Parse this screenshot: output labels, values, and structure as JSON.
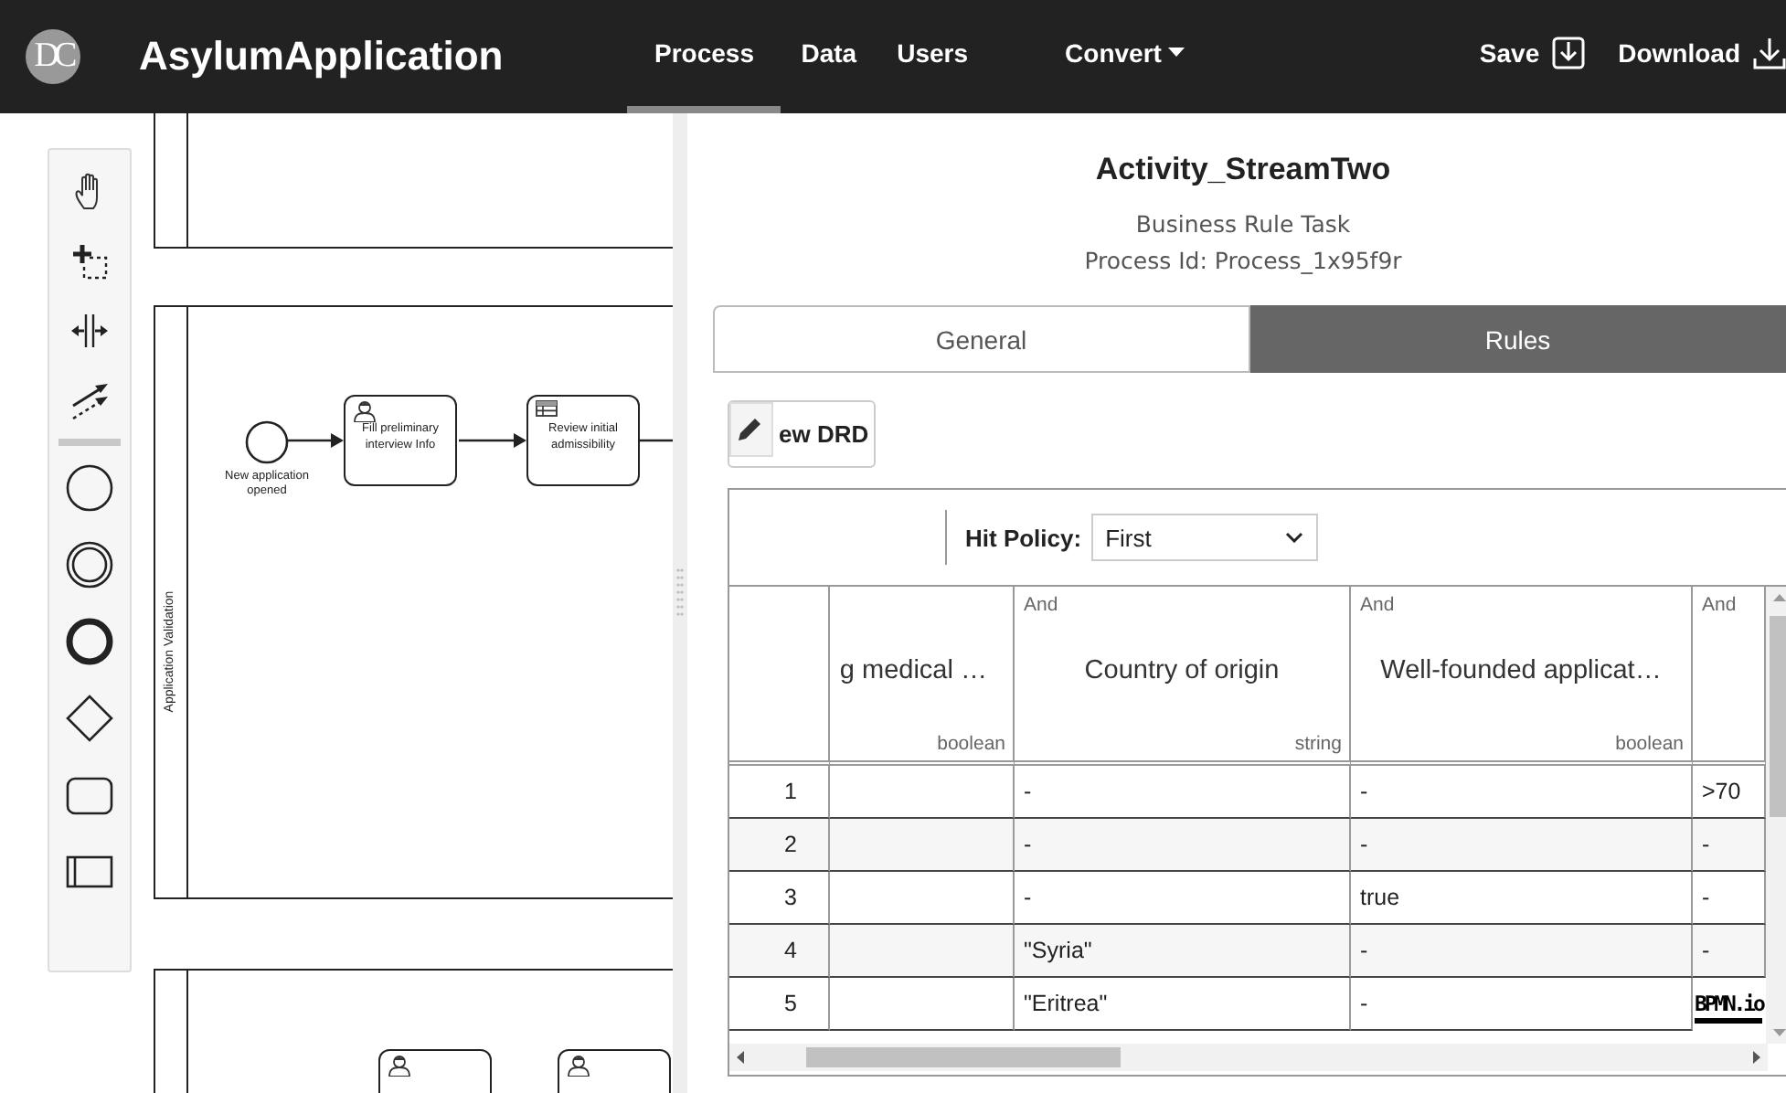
{
  "navbar": {
    "logo_text": "DC",
    "app_title": "AsylumApplication",
    "nav_items": [
      {
        "label": "Process",
        "selected": true
      },
      {
        "label": "Data",
        "selected": false
      },
      {
        "label": "Users",
        "selected": false
      }
    ],
    "convert": {
      "label": "Convert"
    },
    "actions": [
      {
        "label": "Save",
        "kind": "save"
      },
      {
        "label": "Download",
        "kind": "download"
      }
    ]
  },
  "palette": {
    "tools": [
      {
        "kind": "hand"
      },
      {
        "kind": "lasso"
      },
      {
        "kind": "space"
      },
      {
        "kind": "connect"
      },
      {
        "kind": "separator"
      },
      {
        "kind": "start-event"
      },
      {
        "kind": "intermediate-event"
      },
      {
        "kind": "end-event"
      },
      {
        "kind": "gateway"
      },
      {
        "kind": "task"
      },
      {
        "kind": "pool"
      }
    ]
  },
  "canvas": {
    "lane_label": "Application Validation",
    "start_event": {
      "label": "New application opened"
    },
    "tasks": [
      {
        "kind": "user",
        "label": "Fill preliminary interview Info"
      },
      {
        "kind": "business-rule",
        "label": "Review initial admissibility"
      }
    ],
    "lower_tasks": [
      {
        "kind": "user"
      },
      {
        "kind": "user"
      }
    ]
  },
  "panel": {
    "title": "Activity_StreamTwo",
    "subtitle": "Business Rule Task",
    "process_id": "Process Id: Process_1x95f9r",
    "tabs": [
      {
        "label": "General",
        "selected": false
      },
      {
        "label": "Rules",
        "selected": true
      }
    ],
    "view_drd_button": "ew DRD",
    "hit_policy": {
      "label": "Hit Policy:",
      "value": "First"
    },
    "table": {
      "columns": [
        {
          "label": "g medical …",
          "type": "boolean"
        },
        {
          "combinator": "And",
          "label": "Country of origin",
          "type": "string"
        },
        {
          "combinator": "And",
          "label": "Well-founded applicat…",
          "type": "boolean"
        },
        {
          "combinator": "And"
        }
      ],
      "rows": [
        {
          "number": "1",
          "values": [
            "-",
            "-",
            ">70"
          ]
        },
        {
          "number": "2",
          "values": [
            "-",
            "-",
            "-"
          ]
        },
        {
          "number": "3",
          "values": [
            "-",
            "true",
            "-"
          ]
        },
        {
          "number": "4",
          "values": [
            "\"Syria\"",
            "-",
            "-"
          ]
        },
        {
          "number": "5",
          "values": [
            "\"Eritrea\"",
            "-"
          ]
        }
      ]
    },
    "brand_label": "BPMN.io"
  }
}
